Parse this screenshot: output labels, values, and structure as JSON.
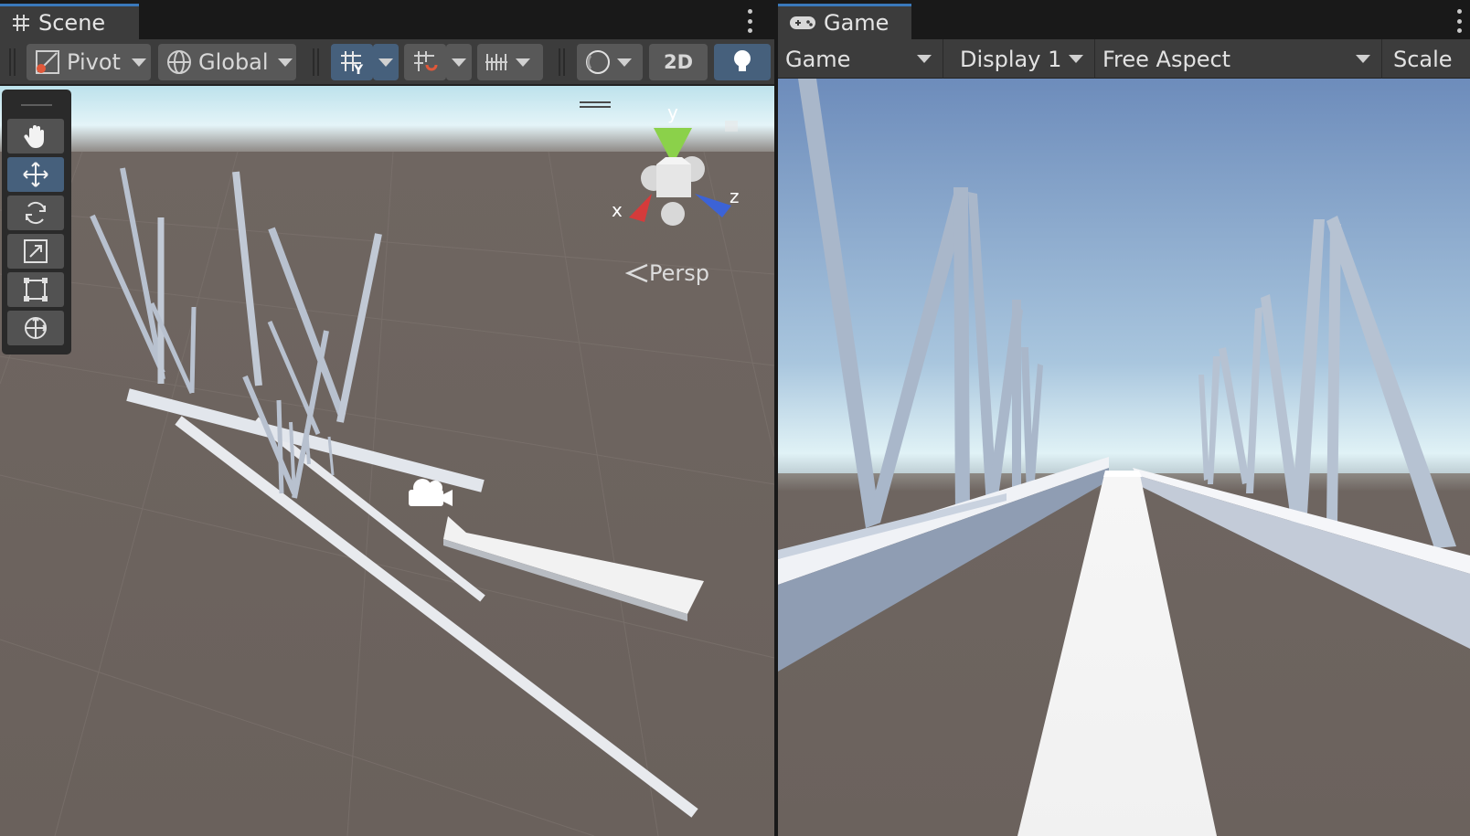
{
  "scene": {
    "tab_label": "Scene",
    "toolbar": {
      "pivot_label": "Pivot",
      "global_label": "Global",
      "mode_2d_label": "2D"
    },
    "tools": [
      "view-tool",
      "move-tool",
      "rotate-tool",
      "scale-tool",
      "rect-tool",
      "transform-tool"
    ],
    "selected_tool": "move-tool",
    "gizmo": {
      "x_label": "x",
      "y_label": "y",
      "z_label": "z"
    },
    "projection_label": "Persp"
  },
  "game": {
    "tab_label": "Game",
    "toolbar": {
      "display_mode_label": "Game",
      "display_label": "Display 1",
      "aspect_label": "Free Aspect",
      "scale_label": "Scale"
    }
  },
  "colors": {
    "accent": "#46607c",
    "tab_highlight": "#3a79bb",
    "ground": "#6b625d",
    "sky_top": "#6d8cbb",
    "horizon": "#ddf0f6",
    "object": "#c8d0dc"
  }
}
